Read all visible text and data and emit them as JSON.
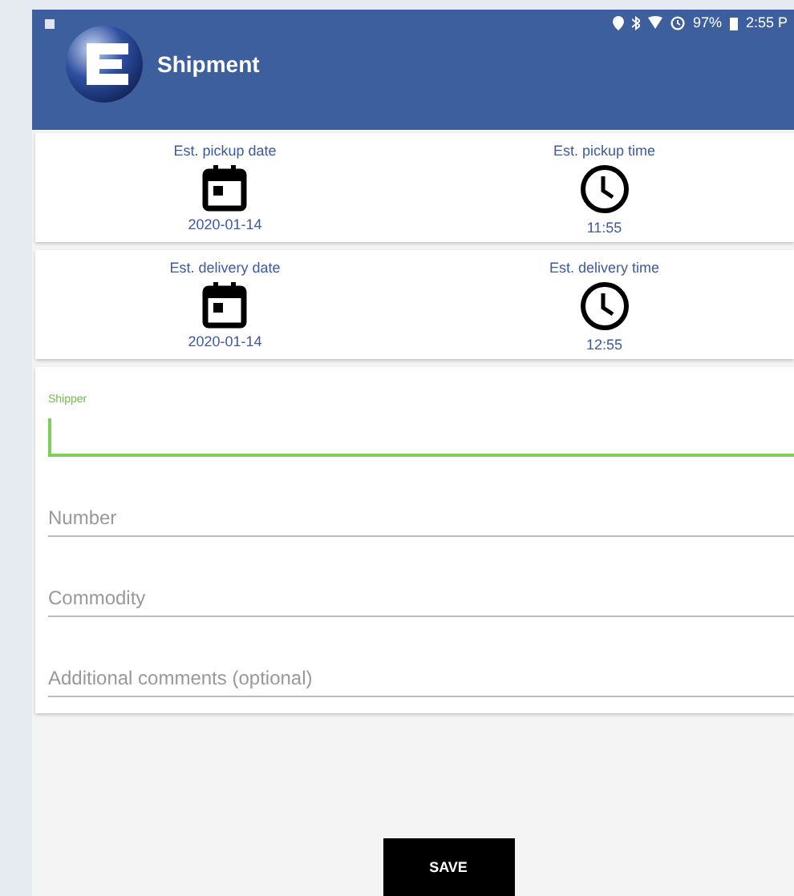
{
  "status_bar": {
    "battery": "97%",
    "time": "2:55 P"
  },
  "app_bar": {
    "title": "Shipment"
  },
  "schedule_cards": [
    {
      "items": [
        {
          "kind": "date",
          "label": "Est. pickup date",
          "value": "2020-01-14"
        },
        {
          "kind": "time",
          "label": "Est. pickup time",
          "value": "11:55"
        }
      ]
    },
    {
      "items": [
        {
          "kind": "date",
          "label": "Est. delivery date",
          "value": "2020-01-14"
        },
        {
          "kind": "time",
          "label": "Est. delivery time",
          "value": "12:55"
        }
      ]
    }
  ],
  "fields": [
    {
      "label": "Shipper",
      "focused": true
    },
    {
      "placeholder": "Number",
      "focused": false
    },
    {
      "placeholder": "Commodity",
      "focused": false
    },
    {
      "placeholder": "Additional comments (optional)",
      "focused": false
    }
  ],
  "save_button": "SAVE"
}
